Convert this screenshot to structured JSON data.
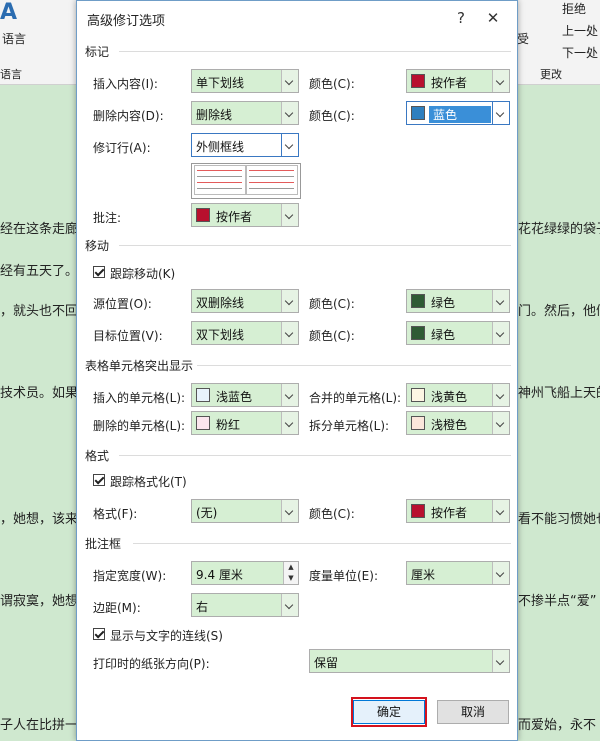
{
  "dialog": {
    "title": "高级修订选项",
    "help_label": "?",
    "close_label": "✕"
  },
  "background": {
    "ribbon": {
      "lang_label": "语言",
      "lang_group": "语言",
      "reject_label": "拒绝",
      "prev_label": "上一处",
      "next_label": "下一处",
      "changes_group": "更改",
      "accept_fragment": "受"
    },
    "doc_lines": [
      {
        "left": "经在这条走廊",
        "right": "花花绿绿的袋子"
      },
      {
        "left": "经有五天了。",
        "right": ""
      },
      {
        "left": "，就头也不回",
        "right": "门。然后，他们"
      },
      {
        "left": "技术员。如果",
        "right": "神州飞船上天的"
      },
      {
        "left": "，她想，该来",
        "right": "看不能习惯她也"
      },
      {
        "left": "谓寂寞，她想",
        "right": "不掺半点“爱”"
      },
      {
        "left": "子人在比拼一",
        "right": "而爱始，永不"
      }
    ]
  },
  "sections": {
    "markup": "标记",
    "moves": "移动",
    "table": "表格单元格突出显示",
    "format": "格式",
    "balloons": "批注框"
  },
  "markup": {
    "insert_label": "插入内容(I):",
    "insert_value": "单下划线",
    "insert_color_label": "颜色(C):",
    "insert_color_value": "按作者",
    "delete_label": "删除内容(D):",
    "delete_value": "删除线",
    "delete_color_label": "颜色(C):",
    "delete_color_value": "蓝色",
    "changed_lines_label": "修订行(A):",
    "changed_lines_value": "外侧框线",
    "comments_label": "批注:",
    "comments_value": "按作者"
  },
  "moves": {
    "track_moves_label": "跟踪移动(K)",
    "track_moves_checked": true,
    "from_label": "源位置(O):",
    "from_value": "双删除线",
    "from_color_label": "颜色(C):",
    "from_color_value": "绿色",
    "to_label": "目标位置(V):",
    "to_value": "双下划线",
    "to_color_label": "颜色(C):",
    "to_color_value": "绿色"
  },
  "table": {
    "inserted_label": "插入的单元格(L):",
    "inserted_value": "浅蓝色",
    "merged_label": "合并的单元格(L):",
    "merged_value": "浅黄色",
    "deleted_label": "删除的单元格(L):",
    "deleted_value": "粉红",
    "split_label": "拆分单元格(L):",
    "split_value": "浅橙色"
  },
  "format": {
    "track_format_label": "跟踪格式化(T)",
    "track_format_checked": true,
    "format_label": "格式(F):",
    "format_value": "(无)",
    "format_color_label": "颜色(C):",
    "format_color_value": "按作者"
  },
  "balloons": {
    "width_label": "指定宽度(W):",
    "width_value": "9.4 厘米",
    "unit_label": "度量单位(E):",
    "unit_value": "厘米",
    "margin_label": "边距(M):",
    "margin_value": "右",
    "show_lines_label": "显示与文字的连线(S)",
    "show_lines_checked": true,
    "orientation_label": "打印时的纸张方向(P):",
    "orientation_value": "保留"
  },
  "buttons": {
    "ok_label": "确定",
    "cancel_label": "取消"
  },
  "colors": {
    "by_author": "#b8102e",
    "blue": "#2e7fbf",
    "green": "#2f5b34",
    "light_blue": "#e8f3fb",
    "light_yellow": "#fdf6e3",
    "pink": "#fbe6ee",
    "light_orange": "#fbe7db",
    "highlight": "#3a8fd8"
  }
}
